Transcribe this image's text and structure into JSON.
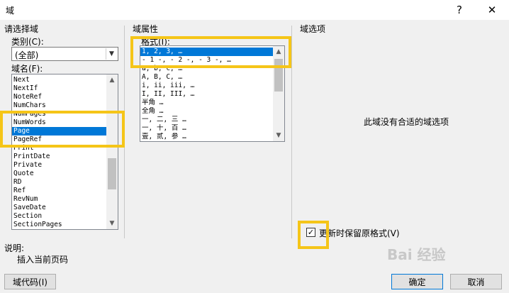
{
  "window": {
    "title": "域",
    "help_glyph": "?",
    "close_glyph": "✕"
  },
  "select_field": {
    "heading": "请选择域",
    "category_label": "类别(C):",
    "category_value": "(全部)",
    "fieldname_label": "域名(F):",
    "field_names": [
      "Next",
      "NextIf",
      "NoteRef",
      "NumChars",
      "NumPages",
      "NumWords",
      "Page",
      "PageRef",
      "Print",
      "PrintDate",
      "Private",
      "Quote",
      "RD",
      "Ref",
      "RevNum",
      "SaveDate",
      "Section",
      "SectionPages"
    ],
    "selected_index": 6
  },
  "field_properties": {
    "heading": "域属性",
    "format_label": "格式(I):",
    "formats": [
      "1, 2, 3, …",
      "- 1 -, - 2 -, - 3 -, …",
      "a, b, c, …",
      "A, B, C, …",
      "i, ii, iii, …",
      "I, II, III, …",
      "半角 …",
      "全角 …",
      "一, 二, 三 …",
      "一, 十, 百 …",
      "壹, 贰, 参 …"
    ],
    "selected_index": 0
  },
  "field_options": {
    "heading": "域选项",
    "empty_message": "此域没有合适的域选项",
    "preserve_format_label": "更新时保留原格式(V)",
    "preserve_format_checked": true,
    "check_glyph": "✓"
  },
  "description": {
    "heading": "说明:",
    "text": "插入当前页码"
  },
  "buttons": {
    "field_codes": "域代码(I)",
    "ok": "确定",
    "cancel": "取消"
  },
  "watermark": {
    "text": "Bai 经验"
  },
  "colors": {
    "selection": "#0078d7",
    "highlight_box": "#f5c518"
  }
}
